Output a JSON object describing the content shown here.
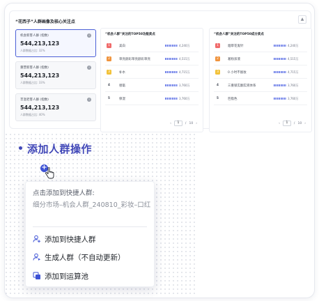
{
  "panel": {
    "title": "“花西子”人群画像及核心关注点",
    "ctrl_icon": "collapse-icon",
    "ctrl_glyph": "▲"
  },
  "metrics": [
    {
      "label": "机会新客人群 (指数)",
      "value": "544,213,123",
      "ratio": "人群数据占比: 32%",
      "selected": true
    },
    {
      "label": "重营新客人群 (指数)",
      "value": "544,213,123",
      "ratio": "人群数据占比: 33%",
      "selected": false
    },
    {
      "label": "丰温老客人群 (指数)",
      "value": "544,213,123",
      "ratio": "人群数据占比: 40%",
      "selected": false
    }
  ],
  "rank_left": {
    "title": "“机会人群”关注的TOP50功能卖点",
    "rows": [
      {
        "no": "1",
        "name": "美白",
        "value": "4,240万",
        "color": "#f06b6b"
      },
      {
        "no": "2",
        "name": "草亮颜彩草亮颜彩草亮",
        "value": "4,515万",
        "color": "#f0943e"
      },
      {
        "no": "3",
        "name": "补水",
        "value": "4,715万",
        "color": "#f2c23a"
      },
      {
        "no": "4",
        "name": "替氨",
        "value": "3,760万",
        "color": ""
      },
      {
        "no": "5",
        "name": "保湿",
        "value": "3,760万",
        "color": ""
      }
    ],
    "pager": {
      "prev": "‹",
      "page": "1",
      "sep": "/",
      "total": "10",
      "next": "›"
    }
  },
  "rank_right": {
    "title": "“机会人群”关注的TOP50成分卖点",
    "rows": [
      {
        "no": "1",
        "name": "烟草花鬼针",
        "value": "4,240万",
        "color": "#f06b6b"
      },
      {
        "no": "2",
        "name": "葛粉孩液",
        "value": "4,515万",
        "color": "#f0943e"
      },
      {
        "no": "3",
        "name": "0 小时不脱妆",
        "value": "4,715万",
        "color": "#f2c23a"
      },
      {
        "no": "4",
        "name": "三重锁实翻实液体系",
        "value": "3,760万",
        "color": ""
      },
      {
        "no": "5",
        "name": "巨脂色",
        "value": "3,760万",
        "color": ""
      }
    ],
    "pager": {
      "prev": "‹",
      "page": "1",
      "sep": "/",
      "total": "10",
      "next": "›"
    }
  },
  "operation": {
    "title": "添加人群操作",
    "plus_glyph": "+",
    "popup": {
      "line1": "点击添加到快捷人群:",
      "line2": "细分市场–机会人群_240810_彩妆–口红",
      "items": [
        {
          "label": "添加到快捷人群",
          "icon": "add-user-icon"
        },
        {
          "label": "生成人群（不自动更新）",
          "icon": "generate-user-icon"
        },
        {
          "label": "添加到运算池",
          "icon": "copy-icon"
        }
      ]
    }
  },
  "colors": {
    "accent": "#3d52d5",
    "title": "#4148b8"
  }
}
